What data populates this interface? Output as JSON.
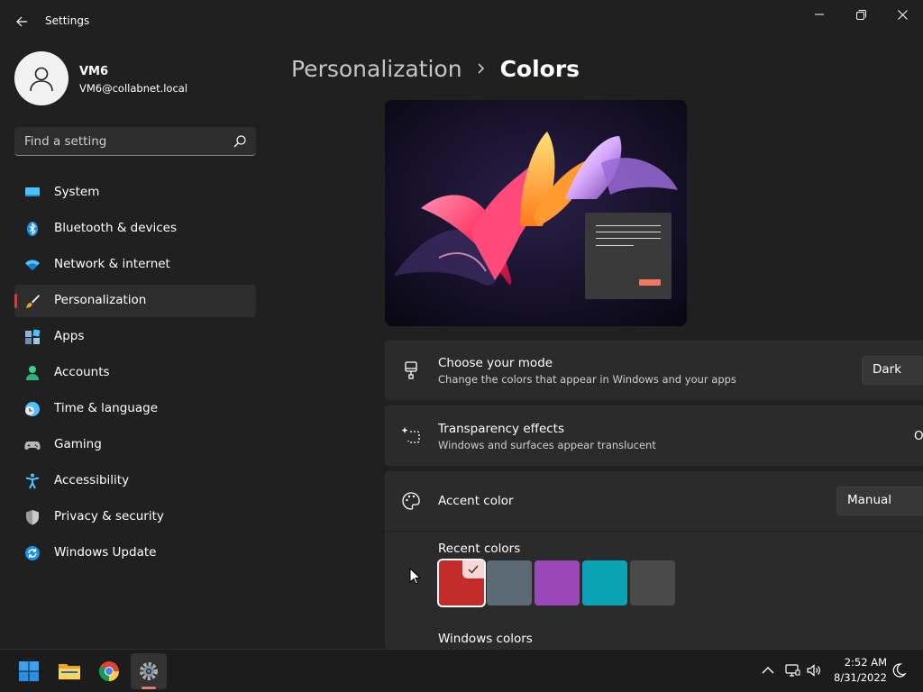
{
  "window": {
    "title": "Settings",
    "controls": [
      "minimize-icon",
      "restore-icon",
      "close-icon"
    ]
  },
  "user": {
    "name": "VM6",
    "email": "VM6@collabnet.local"
  },
  "search": {
    "placeholder": "Find a setting"
  },
  "sidebar": {
    "selected": "Personalization",
    "items": [
      {
        "label": "System",
        "icon": "system-icon"
      },
      {
        "label": "Bluetooth & devices",
        "icon": "bluetooth-icon"
      },
      {
        "label": "Network & internet",
        "icon": "wifi-icon"
      },
      {
        "label": "Personalization",
        "icon": "brush-icon"
      },
      {
        "label": "Apps",
        "icon": "apps-icon"
      },
      {
        "label": "Accounts",
        "icon": "person-icon"
      },
      {
        "label": "Time & language",
        "icon": "clock-globe-icon"
      },
      {
        "label": "Gaming",
        "icon": "gamepad-icon"
      },
      {
        "label": "Accessibility",
        "icon": "accessibility-icon"
      },
      {
        "label": "Privacy & security",
        "icon": "shield-icon"
      },
      {
        "label": "Windows Update",
        "icon": "update-icon"
      }
    ]
  },
  "breadcrumb": {
    "parent": "Personalization",
    "current": "Colors"
  },
  "cards": {
    "mode": {
      "title": "Choose your mode",
      "subtitle": "Change the colors that appear in Windows and your apps",
      "value": "Dark"
    },
    "transparency": {
      "title": "Transparency effects",
      "subtitle": "Windows and surfaces appear translucent",
      "toggle_label": "O"
    },
    "accent": {
      "title": "Accent color",
      "value": "Manual"
    }
  },
  "recent_colors": {
    "title": "Recent colors",
    "swatches": [
      "#c42b2b",
      "#5b6a75",
      "#9a48b8",
      "#0aa3b3",
      "#4a4a4a"
    ],
    "selected_index": 0
  },
  "windows_colors": {
    "title": "Windows colors"
  },
  "accent_color": "#d83b3b",
  "taskbar": {
    "apps": [
      "windows-start-icon",
      "file-explorer-icon",
      "chrome-icon",
      "settings-gear-icon"
    ],
    "time": "2:52 AM",
    "date": "8/31/2022"
  }
}
